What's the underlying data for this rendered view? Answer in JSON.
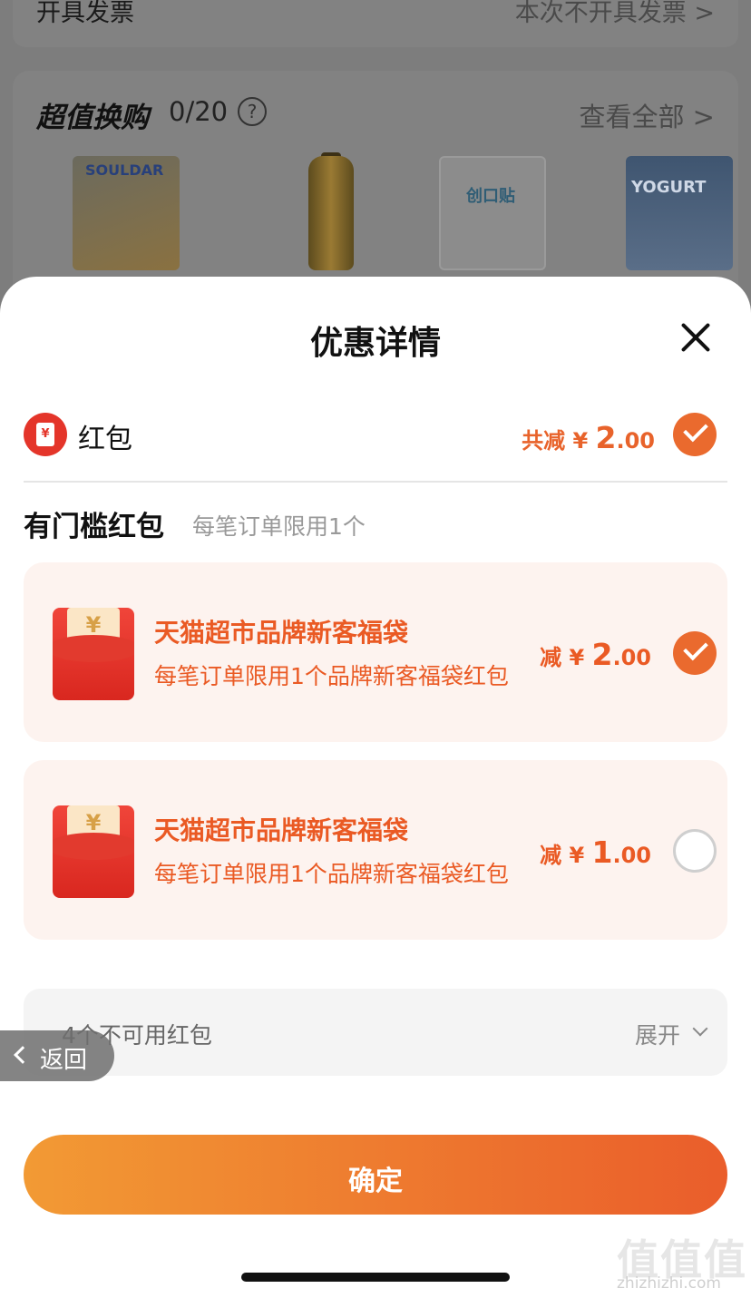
{
  "background": {
    "invoice": {
      "label": "开具发票",
      "value": "本次不开具发票 >"
    },
    "exchange": {
      "title": "超值换购",
      "count": "0/20",
      "help_icon": "question-circle-icon",
      "view_all": "查看全部 >",
      "products": [
        {
          "label": "SOULDAR"
        },
        {
          "label": ""
        },
        {
          "label": "创口贴"
        },
        {
          "label": "YOGURT"
        }
      ]
    }
  },
  "sheet": {
    "title": "优惠详情",
    "close_icon": "close-icon",
    "red_packet": {
      "label": "红包",
      "icon_glyph": "¥",
      "total_prefix": "共减 ¥ ",
      "total_int": "2",
      "total_dec": ".00",
      "checked": true
    },
    "section": {
      "title": "有门槛红包",
      "subtitle": "每笔订单限用1个"
    },
    "coupons": [
      {
        "glyph": "¥",
        "name": "天猫超市品牌新客福袋",
        "desc": "每笔订单限用1个品牌新客福袋红包",
        "amount_prefix": "减 ¥ ",
        "amount_int": "2",
        "amount_dec": ".00",
        "checked": true
      },
      {
        "glyph": "¥",
        "name": "天猫超市品牌新客福袋",
        "desc": "每笔订单限用1个品牌新客福袋红包",
        "amount_prefix": "减 ¥ ",
        "amount_int": "1",
        "amount_dec": ".00",
        "checked": false
      }
    ],
    "unavailable": {
      "text": "4个不可用红包",
      "expand": "展开"
    },
    "back": {
      "text": "返回"
    },
    "confirm": {
      "text": "确定"
    }
  },
  "watermark": {
    "logo": "值值值",
    "url": "zhizhizhi.com"
  },
  "colors": {
    "accent": "#ea5a24",
    "button_start": "#f29a34",
    "button_end": "#ea5d2b",
    "coupon_bg": "#fdf3ef"
  }
}
